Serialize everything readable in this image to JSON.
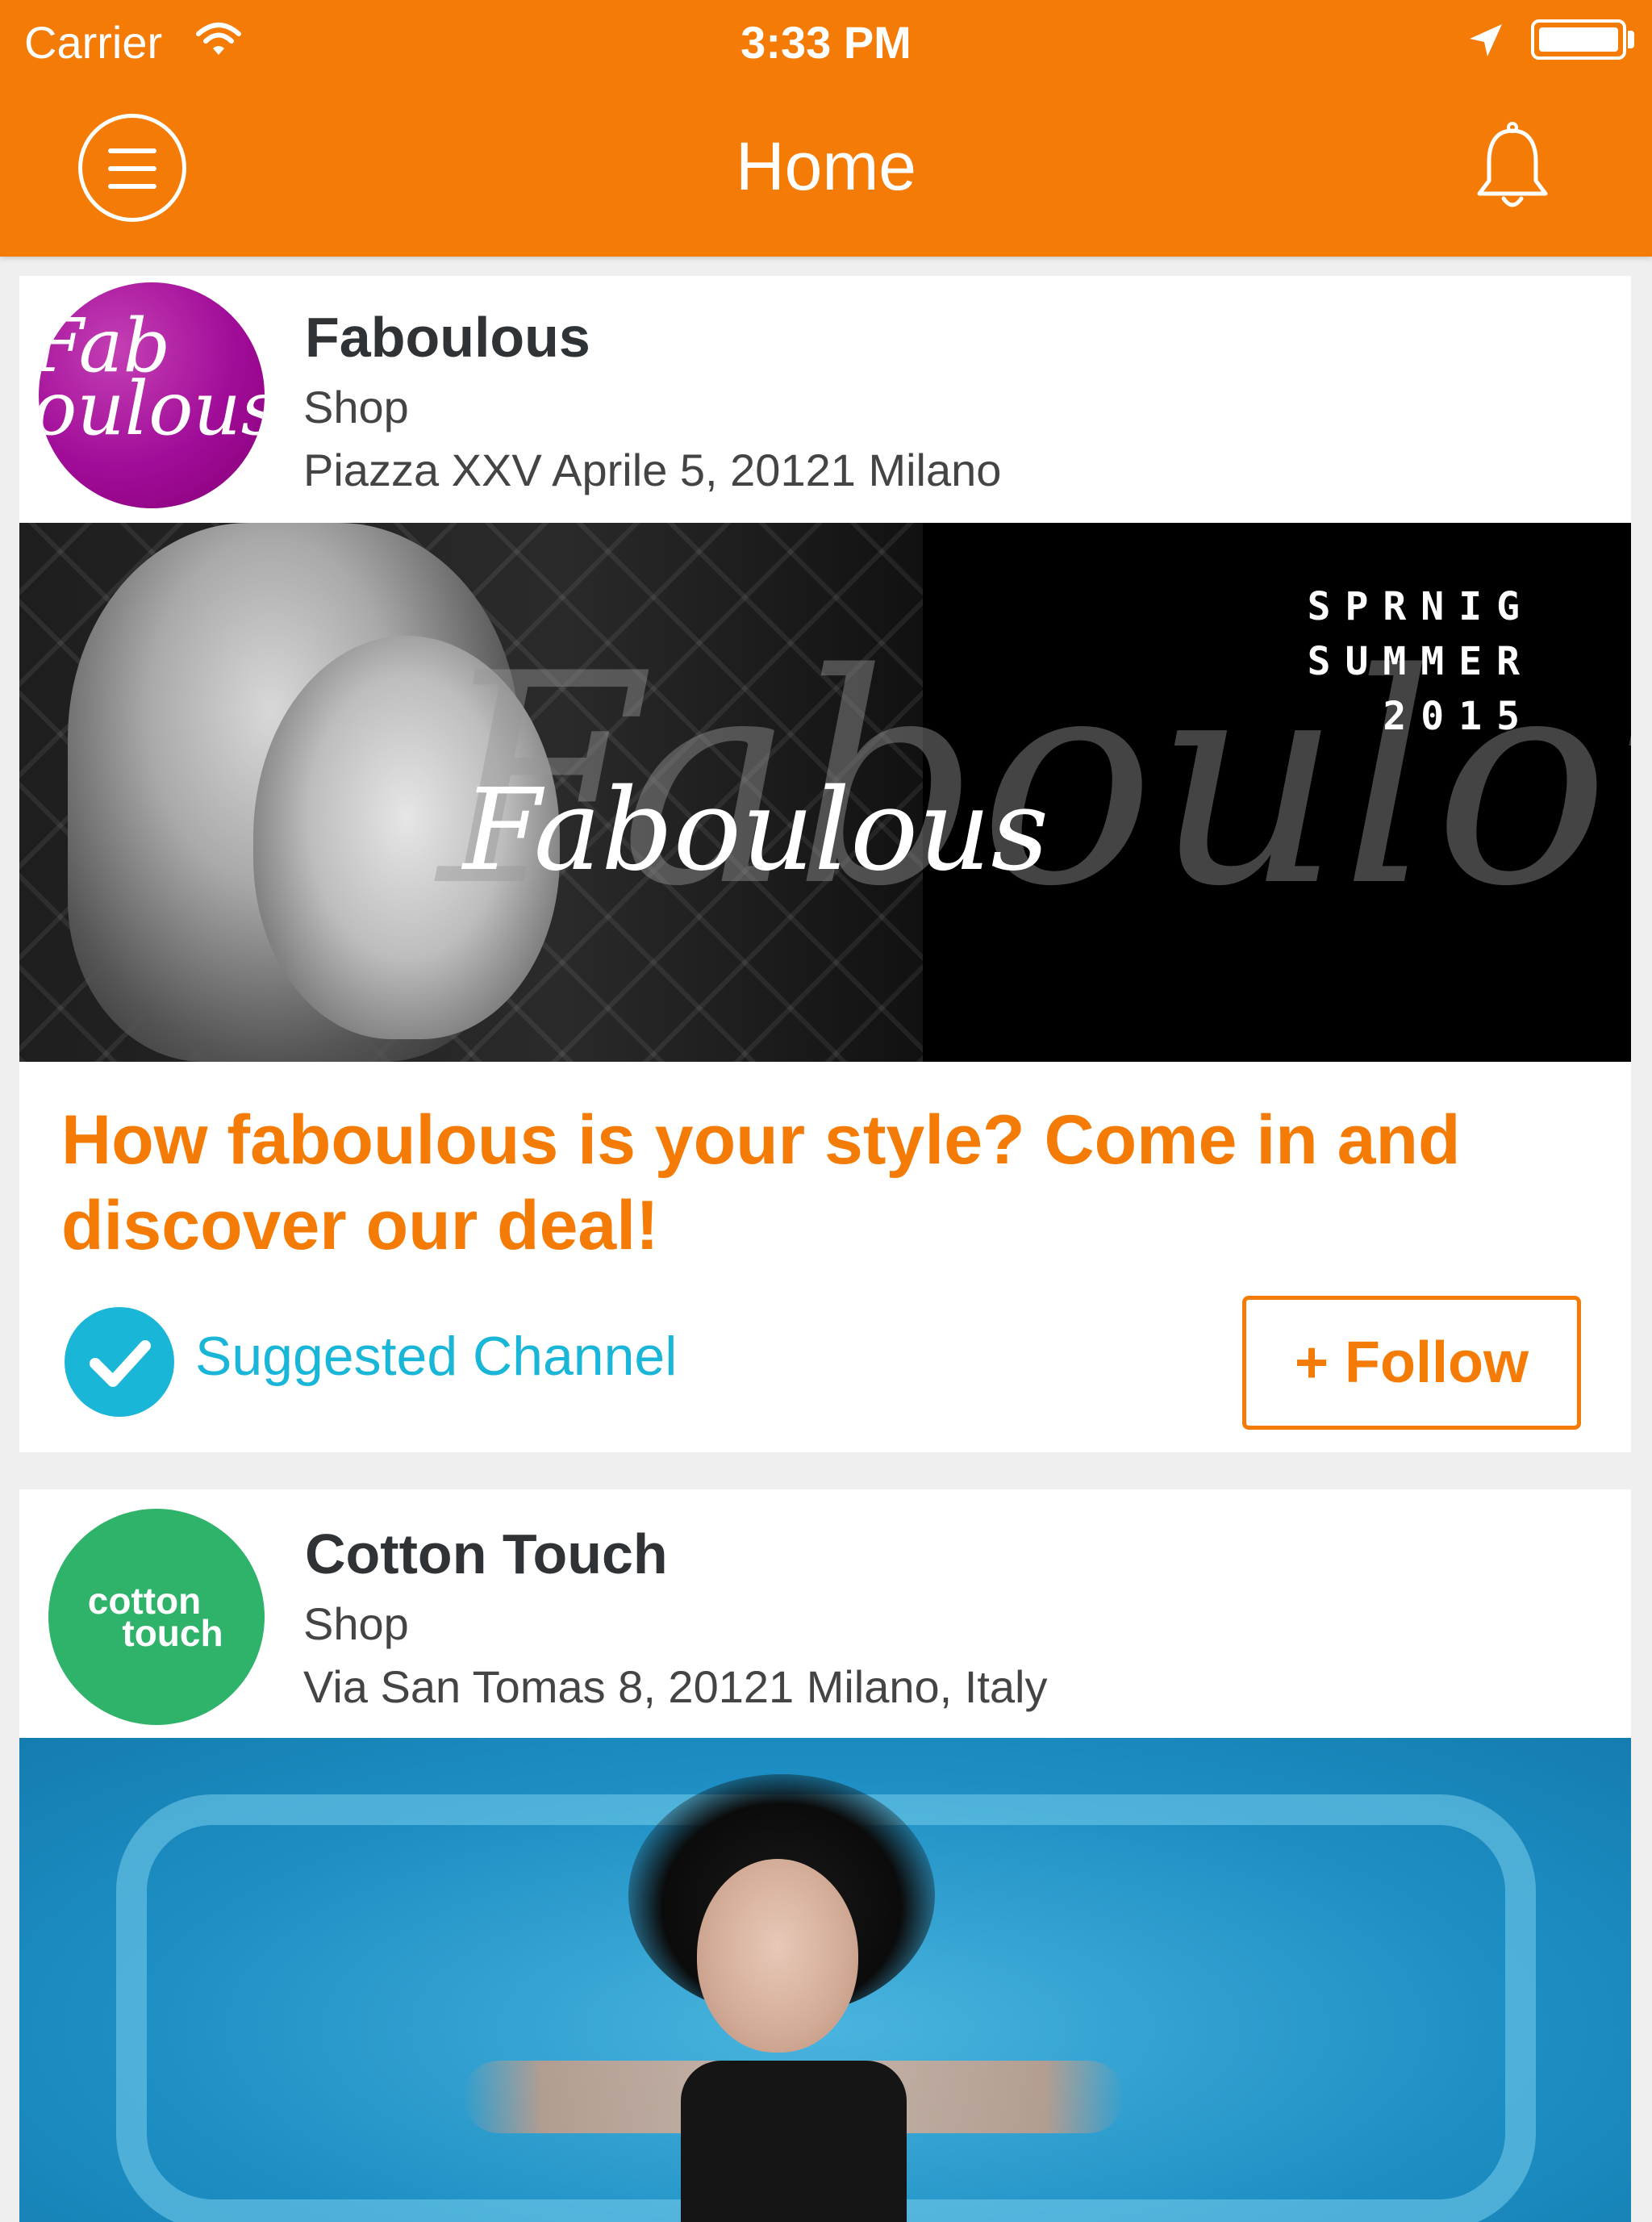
{
  "status_bar": {
    "carrier": "Carrier",
    "time": "3:33 PM"
  },
  "header": {
    "title": "Home",
    "menu_icon": "menu-icon",
    "notification_icon": "bell-icon"
  },
  "colors": {
    "brand_orange": "#f47b06",
    "accent_cyan": "#1ab6d8",
    "cotton_green": "#2fb36a",
    "faboulous_purple": "#a00c98"
  },
  "feed": [
    {
      "name": "Faboulous",
      "type": "Shop",
      "address": "Piazza XXV Aprile 5, 20121 Milano",
      "logo_text": "Fab oulous",
      "banner": {
        "script_text": "Faboulous",
        "season_line1": "SPRNIG",
        "season_line2": "SUMMER",
        "season_line3": "2015"
      },
      "promo": "How faboulous is your style? Come in and discover our deal!",
      "suggested_label": "Suggested Channel",
      "follow_label": "+ Follow"
    },
    {
      "name": "Cotton Touch",
      "type": "Shop",
      "address": "Via San Tomas 8, 20121 Milano, Italy",
      "logo_line1": "cotton",
      "logo_line2": "touch"
    }
  ]
}
